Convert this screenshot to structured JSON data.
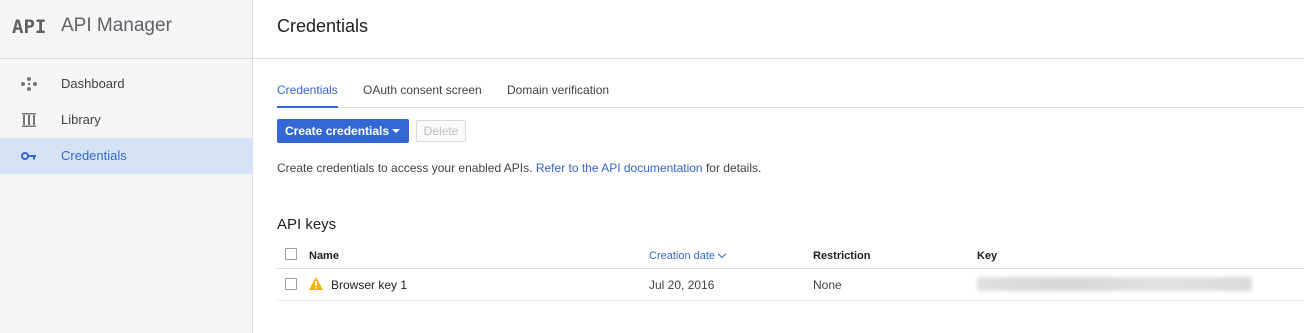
{
  "sidebar": {
    "logo": "API",
    "title": "API Manager",
    "items": [
      {
        "label": "Dashboard",
        "icon": "dashboard-icon"
      },
      {
        "label": "Library",
        "icon": "library-icon"
      },
      {
        "label": "Credentials",
        "icon": "key-icon",
        "active": true
      }
    ]
  },
  "header": {
    "title": "Credentials"
  },
  "tabs": [
    {
      "label": "Credentials",
      "active": true
    },
    {
      "label": "OAuth consent screen"
    },
    {
      "label": "Domain verification"
    }
  ],
  "toolbar": {
    "create_label": "Create credentials",
    "delete_label": "Delete"
  },
  "helper": {
    "prefix": "Create credentials to access your enabled APIs.",
    "link": "Refer to the API documentation",
    "suffix": "for details."
  },
  "api_keys": {
    "title": "API keys",
    "columns": {
      "name": "Name",
      "creation_date": "Creation date",
      "restriction": "Restriction",
      "key": "Key"
    },
    "rows": [
      {
        "name": "Browser key 1",
        "creation_date": "Jul 20, 2016",
        "restriction": "None"
      }
    ]
  },
  "colors": {
    "accent": "#3367d6",
    "sidebar_active": "#d5e2f6",
    "warning": "#f4b400"
  }
}
